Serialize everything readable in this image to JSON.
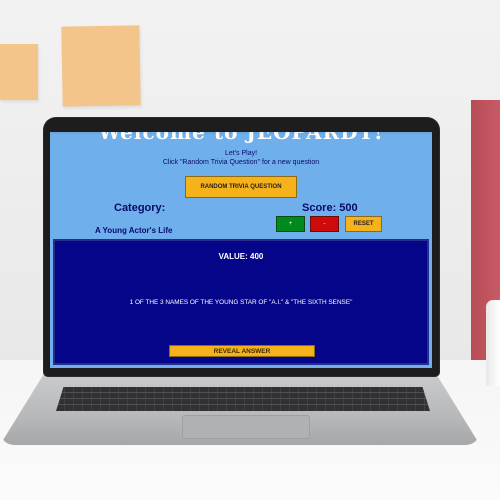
{
  "screen": {
    "title": "Welcome to JEOPARDY!",
    "intro_line_1": "Let's Play!",
    "intro_line_2": "Click \"Random Trivia Question\" for a new question",
    "random_button_label": "RANDOM TRIVIA QUESTION",
    "category_label": "Category:",
    "category_value": "A Young Actor's Life",
    "score_label": "Score: 500",
    "plus_label": "+",
    "minus_label": "-",
    "reset_label": "RESET",
    "value_text": "VALUE: 400",
    "clue_text": "1 OF THE 3 NAMES OF THE YOUNG STAR OF \"A.I.\" & \"THE SIXTH SENSE\"",
    "reveal_label": "REVEAL ANSWER"
  },
  "colors": {
    "page_background": "#6fb0ec",
    "panel_background": "#05058a",
    "accent_button": "#f5b21b",
    "plus_button": "#008a1d",
    "minus_button": "#cf0a0a",
    "text_dark_blue": "#0a0a6a"
  },
  "icons": {
    "plus": "plus-icon",
    "minus": "minus-icon"
  }
}
